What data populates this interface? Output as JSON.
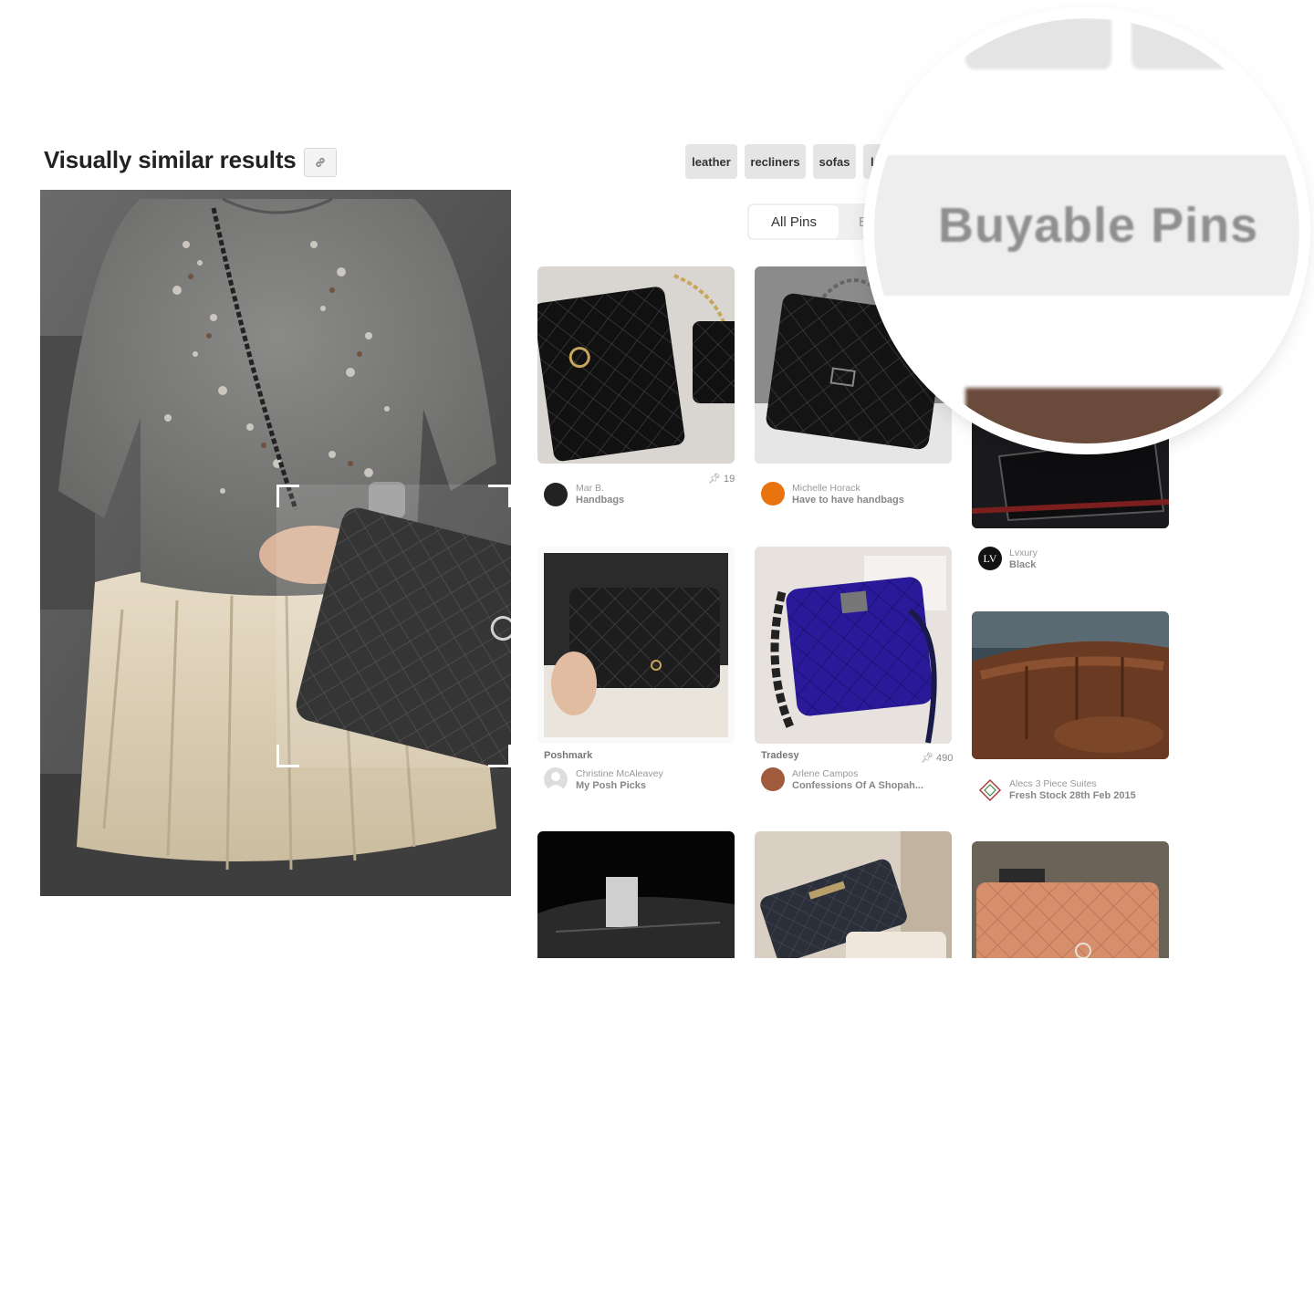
{
  "header": {
    "title": "Visually similar results",
    "link_icon": "link-icon"
  },
  "chips": [
    "leather",
    "recliners",
    "sofas",
    "lea"
  ],
  "tabs": {
    "all_pins": "All Pins",
    "buyable_partial": "Bu"
  },
  "magnifier": {
    "label": "Buyable Pins"
  },
  "pins": [
    {
      "user": "Mar B.",
      "board": "Handbags",
      "count": "19",
      "source": ""
    },
    {
      "user": "Michelle Horack",
      "board": "Have to have handbags",
      "count": "",
      "source": ""
    },
    {
      "user": "Lvxury",
      "board": "Black",
      "count": "",
      "source": "",
      "avatar_text": "LV"
    },
    {
      "user": "Christine McAleavey",
      "board": "My Posh Picks",
      "count": "",
      "source": "Poshmark"
    },
    {
      "user": "Arlene Campos",
      "board": "Confessions Of A Shopah...",
      "count": "490",
      "source": "Tradesy"
    },
    {
      "user": "Alecs 3 Piece Suites",
      "board": "Fresh Stock 28th Feb 2015",
      "count": "",
      "source": ""
    }
  ],
  "colors": {
    "chip_bg": "#e5e5e5",
    "tab_bg": "#efefef",
    "accent_text": "#333333"
  }
}
